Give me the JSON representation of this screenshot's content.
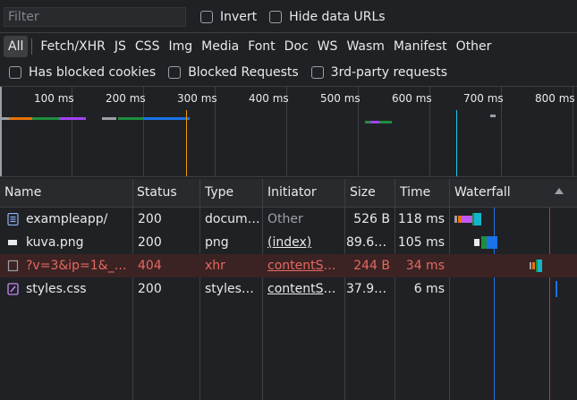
{
  "filter": {
    "placeholder": "Filter"
  },
  "options_row1": [
    {
      "label": "Invert"
    },
    {
      "label": "Hide data URLs"
    }
  ],
  "types": [
    "All",
    "Fetch/XHR",
    "JS",
    "CSS",
    "Img",
    "Media",
    "Font",
    "Doc",
    "WS",
    "Wasm",
    "Manifest",
    "Other"
  ],
  "options_row3": [
    {
      "label": "Has blocked cookies"
    },
    {
      "label": "Blocked Requests"
    },
    {
      "label": "3rd-party requests"
    }
  ],
  "overview": {
    "ticks": [
      "100 ms",
      "200 ms",
      "300 ms",
      "400 ms",
      "500 ms",
      "600 ms",
      "700 ms",
      "800 ms"
    ]
  },
  "columns": [
    "Name",
    "Status",
    "Type",
    "Initiator",
    "Size",
    "Time",
    "Waterfall"
  ],
  "rows": [
    {
      "name": "exampleapp/",
      "status": "200",
      "type": "docum…",
      "initiator": "Other",
      "size": "526 B",
      "time": "118 ms",
      "icon": "document-icon"
    },
    {
      "name": "kuva.png",
      "status": "200",
      "type": "png",
      "initiator": "(index)",
      "size": "89.6 …",
      "time": "105 ms",
      "icon": "image-icon"
    },
    {
      "name": "?v=3&ip=1&_…",
      "status": "404",
      "type": "xhr",
      "initiator": "contentSc…",
      "size": "244 B",
      "time": "34 ms",
      "icon": "xhr-icon"
    },
    {
      "name": "styles.css",
      "status": "200",
      "type": "stylesh…",
      "initiator": "contentSc…",
      "size": "37.9 …",
      "time": "6 ms",
      "icon": "stylesheet-icon"
    }
  ],
  "colors": {
    "background": "#202124",
    "header": "#292a2d",
    "error_text": "#e46962",
    "dom_content_loaded": "#1a73e8",
    "load": "#d93025"
  }
}
